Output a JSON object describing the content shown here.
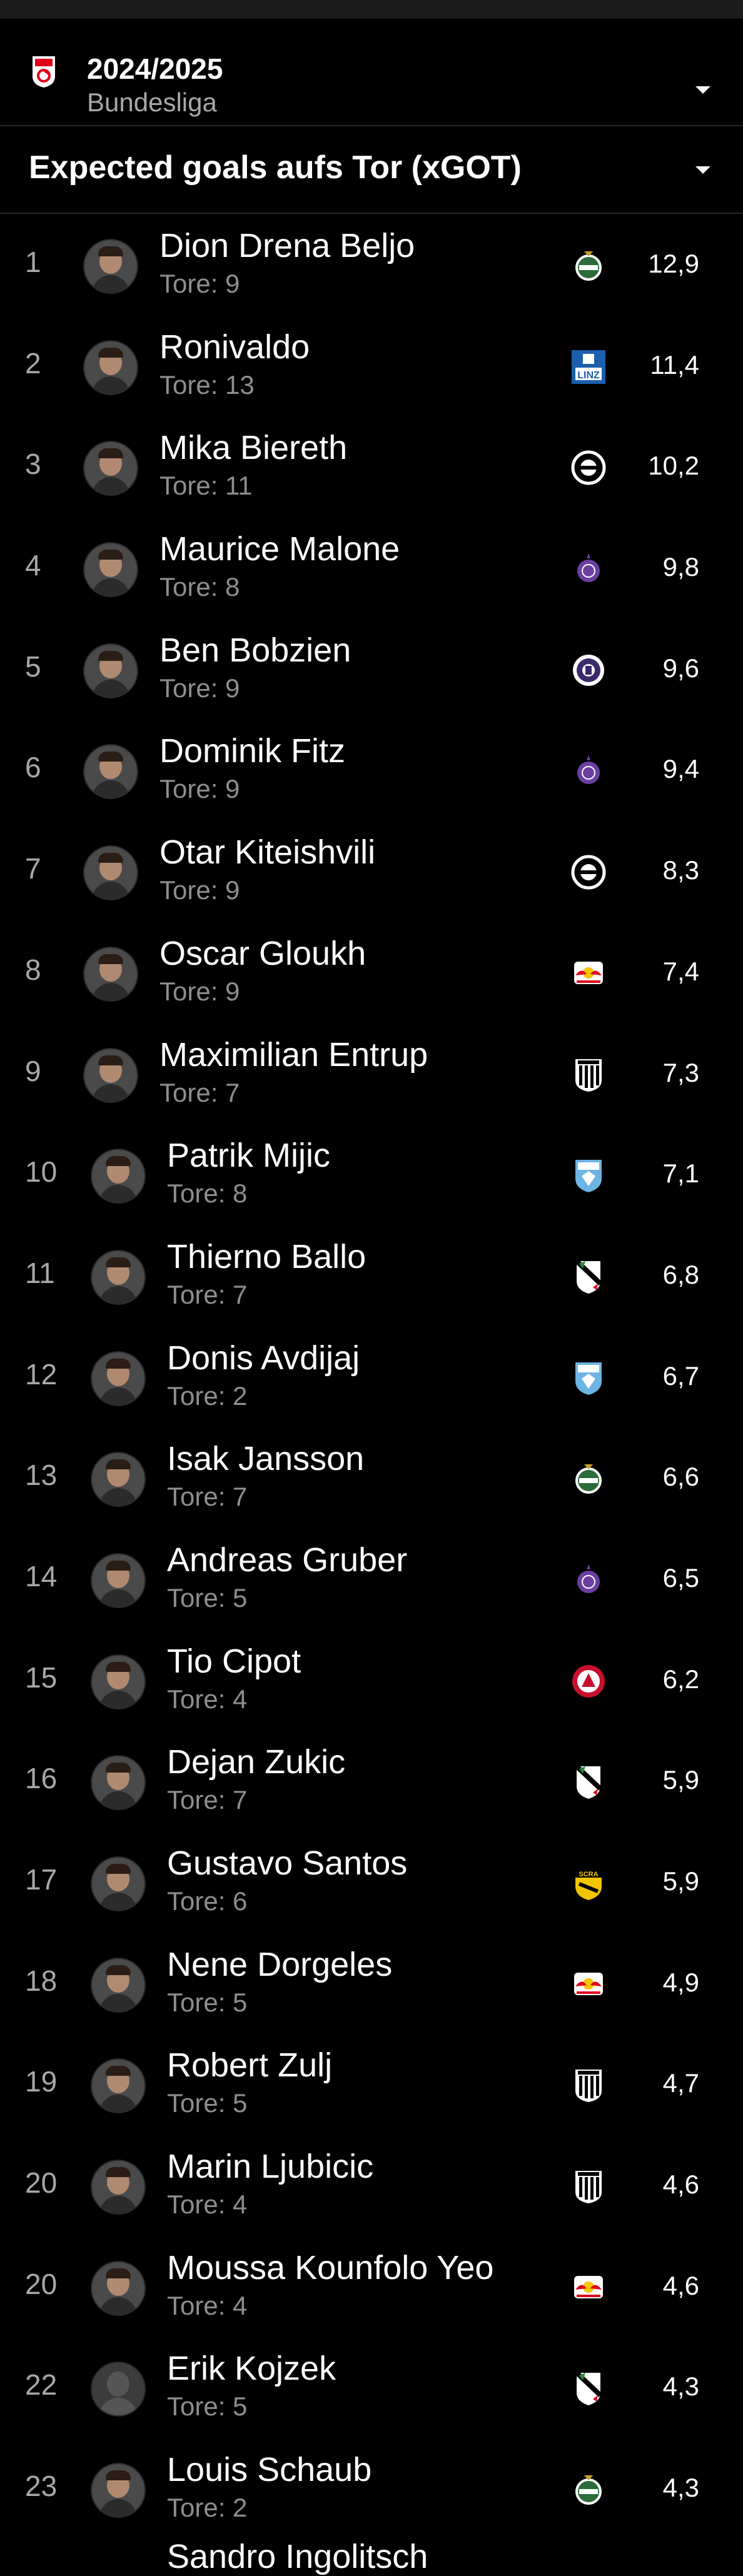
{
  "season": {
    "year": "2024/2025",
    "league": "Bundesliga"
  },
  "metric": {
    "label": "Expected goals aufs Tor (xGOT)"
  },
  "goals_prefix": "Tore:",
  "players": [
    {
      "rank": "1",
      "name": "Dion Drena Beljo",
      "goals": "9",
      "club": "rapid",
      "value": "12,9"
    },
    {
      "rank": "2",
      "name": "Ronivaldo",
      "goals": "13",
      "club": "blauweiss",
      "value": "11,4"
    },
    {
      "rank": "3",
      "name": "Mika Biereth",
      "goals": "11",
      "club": "sturm",
      "value": "10,2"
    },
    {
      "rank": "4",
      "name": "Maurice Malone",
      "goals": "8",
      "club": "austria",
      "value": "9,8"
    },
    {
      "rank": "5",
      "name": "Ben Bobzien",
      "goals": "9",
      "club": "hartberg",
      "value": "9,6"
    },
    {
      "rank": "6",
      "name": "Dominik Fitz",
      "goals": "9",
      "club": "austria",
      "value": "9,4"
    },
    {
      "rank": "7",
      "name": "Otar Kiteishvili",
      "goals": "9",
      "club": "sturm",
      "value": "8,3"
    },
    {
      "rank": "8",
      "name": "Oscar Gloukh",
      "goals": "9",
      "club": "salzburg",
      "value": "7,4"
    },
    {
      "rank": "9",
      "name": "Maximilian Entrup",
      "goals": "7",
      "club": "lask",
      "value": "7,3"
    },
    {
      "rank": "10",
      "name": "Patrik Mijic",
      "goals": "8",
      "club": "wsg",
      "value": "7,1"
    },
    {
      "rank": "11",
      "name": "Thierno Ballo",
      "goals": "7",
      "club": "wac",
      "value": "6,8"
    },
    {
      "rank": "12",
      "name": "Donis Avdijaj",
      "goals": "2",
      "club": "wsg",
      "value": "6,7"
    },
    {
      "rank": "13",
      "name": "Isak Jansson",
      "goals": "7",
      "club": "rapid",
      "value": "6,6"
    },
    {
      "rank": "14",
      "name": "Andreas Gruber",
      "goals": "5",
      "club": "austria",
      "value": "6,5"
    },
    {
      "rank": "15",
      "name": "Tio Cipot",
      "goals": "4",
      "club": "gak",
      "value": "6,2"
    },
    {
      "rank": "16",
      "name": "Dejan Zukic",
      "goals": "7",
      "club": "wac",
      "value": "5,9"
    },
    {
      "rank": "17",
      "name": "Gustavo Santos",
      "goals": "6",
      "club": "altach",
      "value": "5,9"
    },
    {
      "rank": "18",
      "name": "Nene Dorgeles",
      "goals": "5",
      "club": "salzburg",
      "value": "4,9"
    },
    {
      "rank": "19",
      "name": "Robert Zulj",
      "goals": "5",
      "club": "lask",
      "value": "4,7"
    },
    {
      "rank": "20",
      "name": "Marin Ljubicic",
      "goals": "4",
      "club": "lask",
      "value": "4,6"
    },
    {
      "rank": "20",
      "name": "Moussa Kounfolo Yeo",
      "goals": "4",
      "club": "salzburg",
      "value": "4,6"
    },
    {
      "rank": "22",
      "name": "Erik Kojzek",
      "goals": "5",
      "club": "wac",
      "value": "4,3"
    },
    {
      "rank": "23",
      "name": "Louis Schaub",
      "goals": "2",
      "club": "rapid",
      "value": "4,3"
    }
  ],
  "next_partial_name": "Sandro Ingolitsch",
  "colors": {
    "background": "#000000",
    "rank_text": "#a8a8a8",
    "secondary_text": "#8e8e8e",
    "divider": "#262626",
    "austria_purple": "#6b3fa0",
    "salzburg_red": "#e2001a",
    "rapid_green": "#2c6b3a",
    "blauweiss_blue": "#1b5fae",
    "gak_red": "#c8102e",
    "wsg_lightblue": "#6cb4e4"
  }
}
